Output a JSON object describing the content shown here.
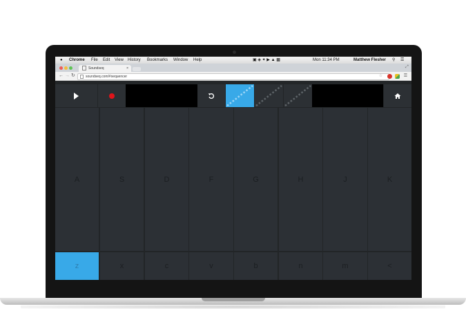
{
  "menubar": {
    "apple": "",
    "app_name": "Chrome",
    "items": [
      "File",
      "Edit",
      "View",
      "History",
      "Bookmarks",
      "Window",
      "Help"
    ],
    "clock": "Mon 11:34 PM",
    "user": "Matthew Flesher"
  },
  "browser": {
    "tab_title": "Soundseq",
    "url": "soundseq.com/#sequencer"
  },
  "colors": {
    "accent": "#38a9e8",
    "record": "#e0141a",
    "key_bg": "#2c3035"
  },
  "controls": {
    "play_icon": "play-icon",
    "record_icon": "record-dot-icon",
    "undo_icon": "undo-icon",
    "home_icon": "home-icon",
    "sequences": [
      {
        "name": "sequence-1",
        "active": true
      },
      {
        "name": "sequence-2",
        "active": false
      },
      {
        "name": "sequence-3",
        "active": false
      }
    ]
  },
  "keys": {
    "top_row": [
      "A",
      "S",
      "D",
      "F",
      "G",
      "H",
      "J",
      "K"
    ],
    "bottom_row": [
      "z",
      "x",
      "c",
      "v",
      "b",
      "n",
      "m",
      "<"
    ],
    "active_key": "z"
  }
}
